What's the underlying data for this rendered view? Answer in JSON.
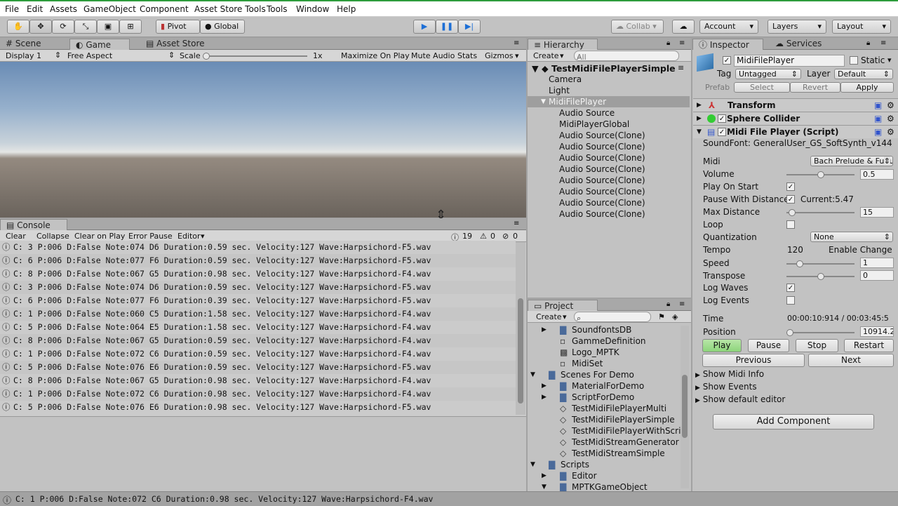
{
  "menu": [
    "File",
    "Edit",
    "Assets",
    "GameObject",
    "Component",
    "Asset Store Tools",
    "Tools",
    "Window",
    "Help"
  ],
  "toolbar": {
    "pivot": "Pivot",
    "global": "Global",
    "collab": "Collab",
    "account": "Account",
    "layers": "Layers",
    "layout": "Layout"
  },
  "scene_tabs": {
    "scene": "Scene",
    "game": "Game",
    "asset_store": "Asset Store"
  },
  "game_bar": {
    "display": "Display 1",
    "aspect": "Free Aspect",
    "scale": "Scale",
    "scale_value": "1x",
    "maximize": "Maximize On Play",
    "mute": "Mute Audio",
    "stats": "Stats",
    "gizmos": "Gizmos"
  },
  "console": {
    "tab": "Console",
    "clear": "Clear",
    "collapse": "Collapse",
    "clear_on_play": "Clear on Play",
    "error_pause": "Error Pause",
    "editor": "Editor",
    "info_count": "19",
    "warn_count": "0",
    "error_count": "0",
    "rows": [
      "C: 3 P:006 D:False Note:074 D6  Duration:0.59 sec. Velocity:127 Wave:Harpsichord-F5.wav",
      "C: 6 P:006 D:False Note:077 F6  Duration:0.59 sec. Velocity:127 Wave:Harpsichord-F5.wav",
      "C: 8 P:006 D:False Note:067 G5  Duration:0.98 sec. Velocity:127 Wave:Harpsichord-F4.wav",
      "C: 3 P:006 D:False Note:074 D6  Duration:0.59 sec. Velocity:127 Wave:Harpsichord-F5.wav",
      "C: 6 P:006 D:False Note:077 F6  Duration:0.39 sec. Velocity:127 Wave:Harpsichord-F5.wav",
      "C: 1 P:006 D:False Note:060 C5  Duration:1.58 sec. Velocity:127 Wave:Harpsichord-F4.wav",
      "C: 5 P:006 D:False Note:064 E5  Duration:1.58 sec. Velocity:127 Wave:Harpsichord-F4.wav",
      "C: 8 P:006 D:False Note:067 G5  Duration:0.59 sec. Velocity:127 Wave:Harpsichord-F4.wav",
      "C: 1 P:006 D:False Note:072 C6  Duration:0.59 sec. Velocity:127 Wave:Harpsichord-F4.wav",
      "C: 5 P:006 D:False Note:076 E6  Duration:0.59 sec. Velocity:127 Wave:Harpsichord-F5.wav",
      "C: 8 P:006 D:False Note:067 G5  Duration:0.98 sec. Velocity:127 Wave:Harpsichord-F4.wav",
      "C: 1 P:006 D:False Note:072 C6  Duration:0.98 sec. Velocity:127 Wave:Harpsichord-F4.wav",
      "C: 5 P:006 D:False Note:076 E6  Duration:0.98 sec. Velocity:127 Wave:Harpsichord-F5.wav"
    ]
  },
  "status": "C: 1 P:006 D:False Note:072 C6  Duration:0.98 sec. Velocity:127 Wave:Harpsichord-F4.wav",
  "hierarchy": {
    "tab": "Hierarchy",
    "create": "Create",
    "search": "All",
    "scene": "TestMidiFilePlayerSimple",
    "items": [
      "Camera",
      "Light",
      "MidiFilePlayer",
      "Audio Source",
      "MidiPlayerGlobal",
      "Audio Source(Clone)",
      "Audio Source(Clone)",
      "Audio Source(Clone)",
      "Audio Source(Clone)",
      "Audio Source(Clone)",
      "Audio Source(Clone)",
      "Audio Source(Clone)",
      "Audio Source(Clone)"
    ]
  },
  "project": {
    "tab": "Project",
    "create": "Create",
    "items": [
      "SoundfontsDB",
      "GammeDefinition",
      "Logo_MPTK",
      "MidiSet",
      "Scenes For Demo",
      "MaterialForDemo",
      "ScriptForDemo",
      "TestMidiFilePlayerMulti",
      "TestMidiFilePlayerSimple",
      "TestMidiFilePlayerWithScrip",
      "TestMidiStreamGenerator",
      "TestMidiStreamSimple",
      "Scripts",
      "Editor",
      "MPTKGameObject"
    ]
  },
  "inspector": {
    "tab": "Inspector",
    "services": "Services",
    "name": "MidiFilePlayer",
    "static": "Static",
    "tag_label": "Tag",
    "tag": "Untagged",
    "layer_label": "Layer",
    "layer": "Default",
    "prefab": "Prefab",
    "select": "Select",
    "revert": "Revert",
    "apply": "Apply",
    "transform": "Transform",
    "sphere": "Sphere Collider",
    "script": "Midi File Player (Script)",
    "soundfont": "SoundFont: GeneralUser_GS_SoftSynth_v144",
    "midi_label": "Midi",
    "midi": "Bach Prelude & Fugu",
    "volume_label": "Volume",
    "volume": "0.5",
    "play_on_start": "Play On Start",
    "pause_distance": "Pause With Distance",
    "current": "Current:5.47",
    "max_distance_label": "Max Distance",
    "max_distance": "15",
    "loop": "Loop",
    "quant_label": "Quantization",
    "quant": "None",
    "tempo_label": "Tempo",
    "tempo": "120",
    "enable_change": "Enable Change",
    "speed_label": "Speed",
    "speed": "1",
    "transpose_label": "Transpose",
    "transpose": "0",
    "log_waves": "Log Waves",
    "log_events": "Log Events",
    "time_label": "Time",
    "time": "00:00:10:914 / 00:03:45:5",
    "position_label": "Position",
    "position": "10914.2",
    "play": "Play",
    "pause": "Pause",
    "stop": "Stop",
    "restart": "Restart",
    "previous": "Previous",
    "next": "Next",
    "show_midi": "Show Midi Info",
    "show_events": "Show Events",
    "show_default": "Show default editor",
    "add_component": "Add Component",
    "volume_level": 0.5,
    "max_distance_level": 0.08,
    "speed_level": 0.2,
    "transpose_level": 0.5,
    "position_level": 0.05
  }
}
